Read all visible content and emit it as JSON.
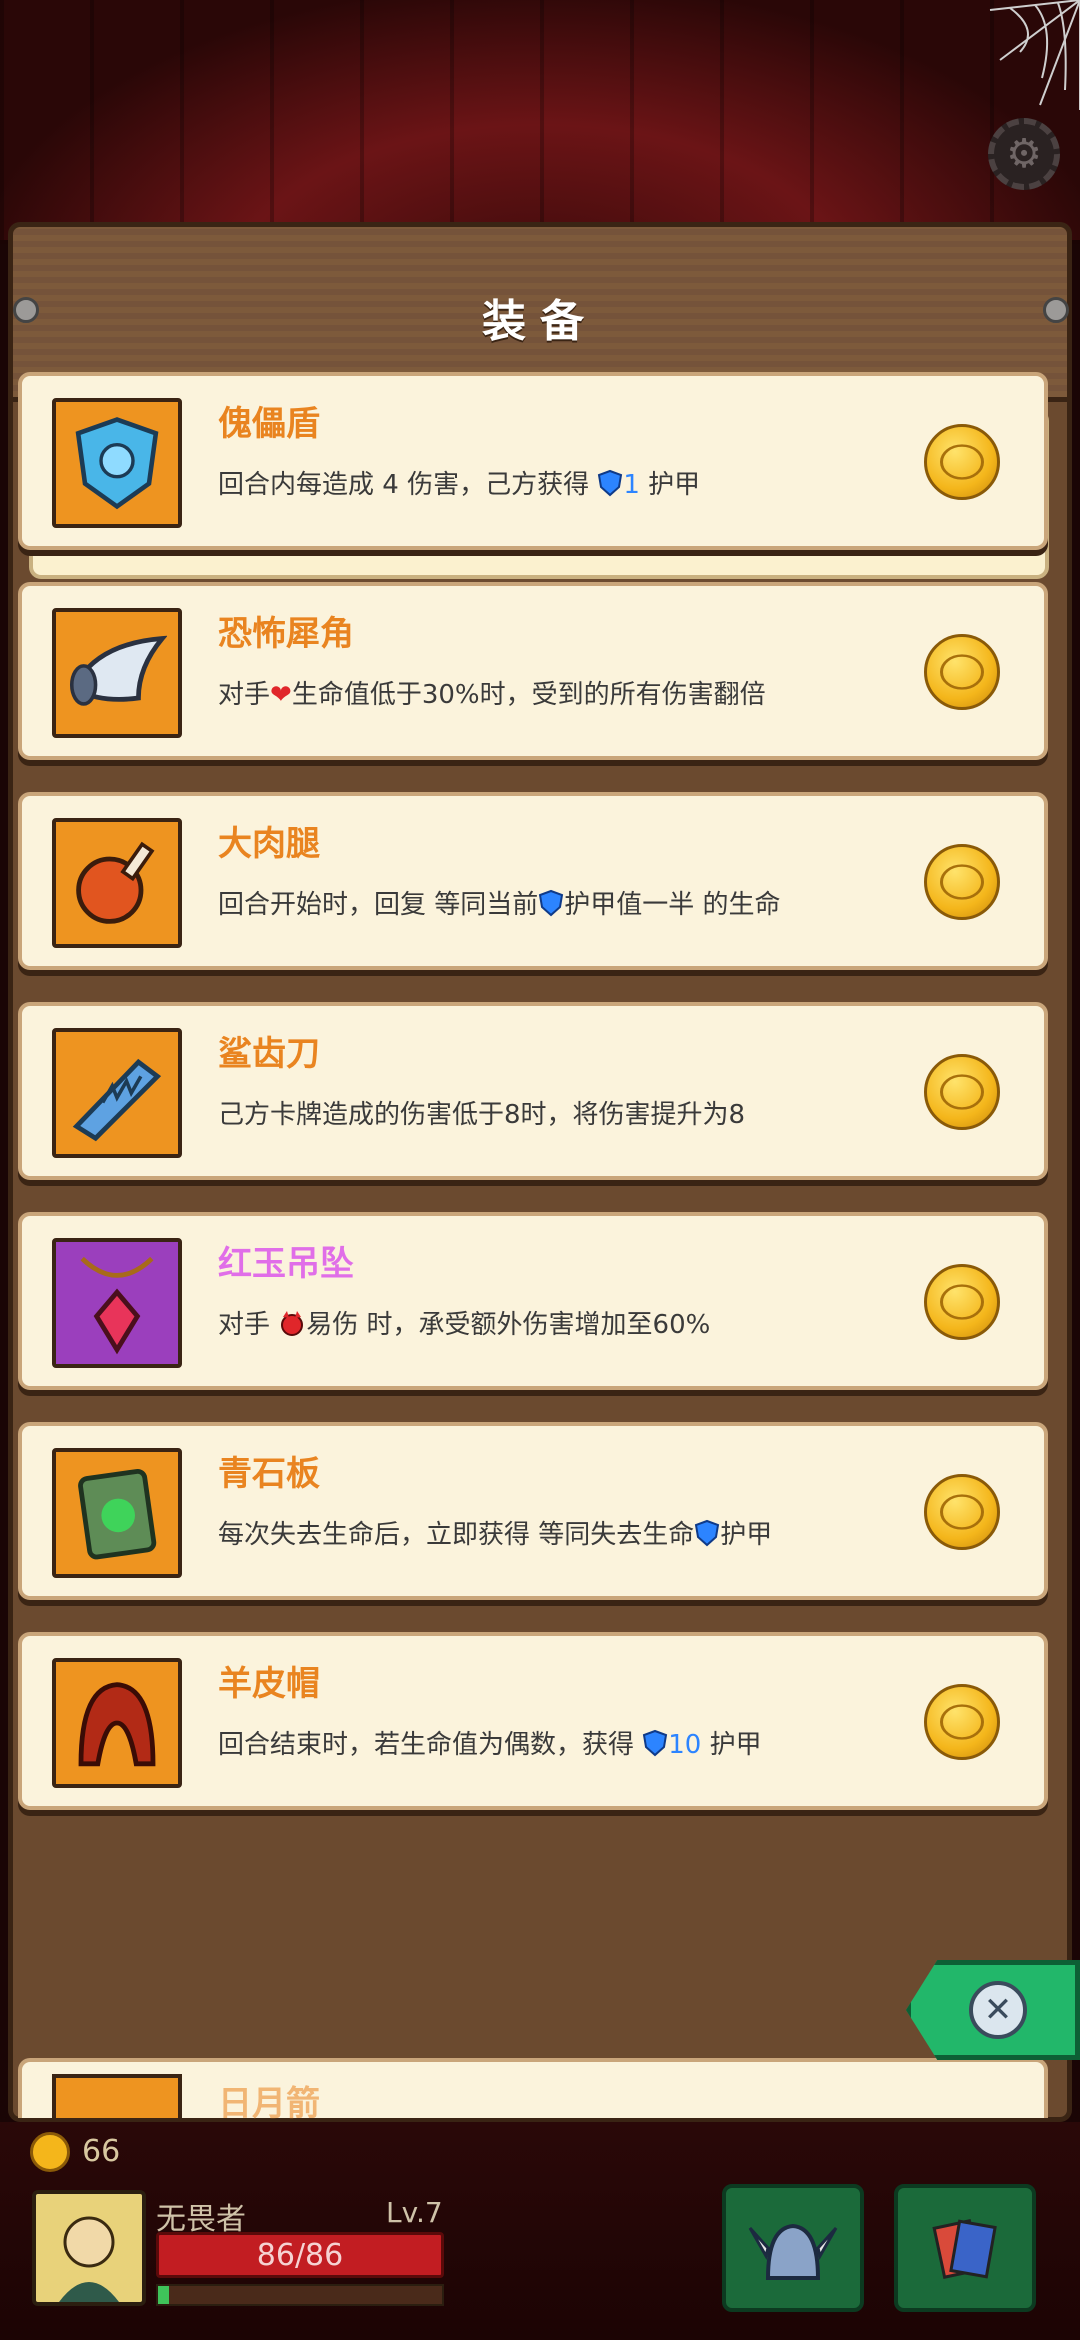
{
  "header": {
    "title": "装备"
  },
  "strip": {
    "icons": [
      "puppet-shield-icon",
      "horn-icon",
      "meat-leg-icon",
      "shark-blade-icon",
      "pendant-icon",
      "stone-slab-icon",
      "sheepskin-hat-icon",
      "gold-coin-icon",
      "scroll-icon",
      "ink-icon"
    ]
  },
  "items": [
    {
      "name": "傀儡盾",
      "desc_pre": "回合内每造成 4 伤害，己方获得 ",
      "desc_value": "1",
      "desc_post": " 护甲",
      "icon": "puppet-shield-icon",
      "thumb": "orange"
    },
    {
      "name": "恐怖犀角",
      "desc_pre": "对手",
      "desc_post": "生命值低于30%时，受到的所有伤害翻倍",
      "icon": "horn-icon",
      "thumb": "orange"
    },
    {
      "name": "大肉腿",
      "desc_pre": "回合开始时，回复 等同当前",
      "desc_post": "护甲值一半 的生命",
      "icon": "meat-leg-icon",
      "thumb": "orange"
    },
    {
      "name": "鲨齿刀",
      "desc_pre": "己方卡牌造成的伤害低于8时，将伤害提升为8",
      "icon": "shark-blade-icon",
      "thumb": "orange"
    },
    {
      "name": "红玉吊坠",
      "desc_pre": "对手 ",
      "desc_post": "易伤 时，承受额外伤害增加至60%",
      "icon": "pendant-icon",
      "thumb": "purple"
    },
    {
      "name": "青石板",
      "desc_pre": "每次失去生命后，立即获得 等同失去生命",
      "desc_post": "护甲",
      "icon": "stone-slab-icon",
      "thumb": "orange"
    },
    {
      "name": "羊皮帽",
      "desc_pre": "回合结束时，若生命值为偶数，获得 ",
      "desc_value": "10",
      "desc_post": " 护甲",
      "icon": "sheepskin-hat-icon",
      "thumb": "orange"
    }
  ],
  "partial_item": {
    "name": "日月箭"
  },
  "player": {
    "gold": "66",
    "name": "无畏者",
    "level": "Lv.7",
    "hp": "86/86",
    "xp_fraction": 0.04
  },
  "colors": {
    "rarity_common": "#ee9420",
    "rarity_epic": "#9b3fbd",
    "name_common": "#e98420",
    "name_epic": "#e06ee8",
    "armor_value": "#2c84ff"
  }
}
